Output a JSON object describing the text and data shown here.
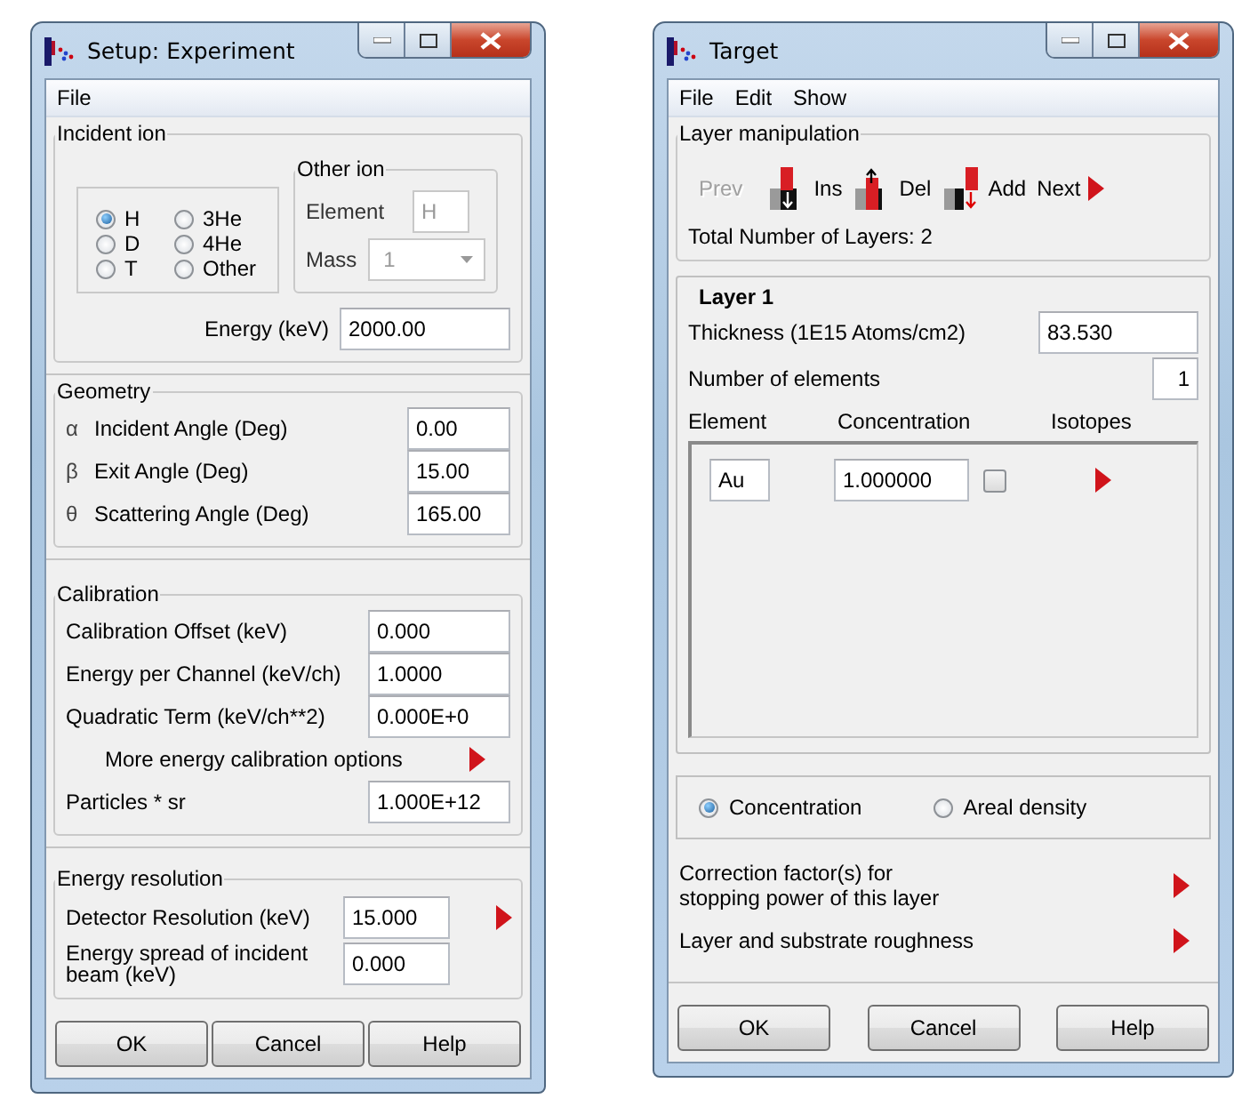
{
  "setup_window": {
    "title": "Setup: Experiment",
    "menu": [
      "File"
    ],
    "incident_ion": {
      "legend": "Incident ion",
      "options": [
        {
          "label": "H",
          "selected": true
        },
        {
          "label": "3He",
          "selected": false
        },
        {
          "label": "D",
          "selected": false
        },
        {
          "label": "4He",
          "selected": false
        },
        {
          "label": "T",
          "selected": false
        },
        {
          "label": "Other",
          "selected": false
        }
      ],
      "other_ion": {
        "legend": "Other ion",
        "element_label": "Element",
        "element_value": "H",
        "mass_label": "Mass",
        "mass_value": "1",
        "disabled": true
      },
      "energy_label": "Energy (keV)",
      "energy_value": "2000.00"
    },
    "geometry": {
      "legend": "Geometry",
      "rows": [
        {
          "symbol": "α",
          "label": "Incident Angle (Deg)",
          "value": "0.00"
        },
        {
          "symbol": "β",
          "label": "Exit Angle (Deg)",
          "value": "15.00"
        },
        {
          "symbol": "θ",
          "label": "Scattering Angle (Deg)",
          "value": "165.00"
        }
      ]
    },
    "calibration": {
      "legend": "Calibration",
      "rows": [
        {
          "kind": "field",
          "label": "Calibration Offset (keV)",
          "value": "0.000"
        },
        {
          "kind": "field",
          "label": "Energy per Channel (keV/ch)",
          "value": "1.0000"
        },
        {
          "kind": "field",
          "label": "Quadratic Term (keV/ch**2)",
          "value": "0.000E+0"
        },
        {
          "kind": "link",
          "label": "More energy calibration options"
        },
        {
          "kind": "field",
          "label": "Particles * sr",
          "value": "1.000E+12"
        }
      ]
    },
    "energy_resolution": {
      "legend": "Energy resolution",
      "rows": [
        {
          "label": "Detector Resolution (keV)",
          "value": "15.000",
          "more": true
        },
        {
          "label": "Energy spread of incident beam (keV)",
          "value": "0.000",
          "more": false
        }
      ]
    },
    "buttons": [
      "OK",
      "Cancel",
      "Help"
    ]
  },
  "target_window": {
    "title": "Target",
    "menu": [
      "File",
      "Edit",
      "Show"
    ],
    "layer_manipulation": {
      "legend": "Layer manipulation",
      "actions": [
        {
          "kind": "prev",
          "label": "Prev",
          "disabled": true
        },
        {
          "kind": "insert",
          "label": "Ins",
          "disabled": false
        },
        {
          "kind": "delete",
          "label": "Del",
          "disabled": false
        },
        {
          "kind": "add",
          "label": "Add",
          "disabled": false
        },
        {
          "kind": "next",
          "label": "Next",
          "disabled": false
        }
      ],
      "total": "Total Number of Layers: 2"
    },
    "layer": {
      "title": "Layer 1",
      "thickness_label": "Thickness (1E15 Atoms/cm2)",
      "thickness_value": "83.530",
      "count_label": "Number of elements",
      "count_value": "1",
      "columns": [
        "Element",
        "Concentration",
        "Isotopes"
      ],
      "elements": [
        {
          "element": "Au",
          "concentration": "1.000000",
          "checked": false
        }
      ]
    },
    "modes": [
      {
        "label": "Concentration",
        "selected": true
      },
      {
        "label": "Areal density",
        "selected": false
      }
    ],
    "links": [
      "Correction factor(s) for stopping power of this layer",
      "Layer and substrate roughness"
    ],
    "buttons": [
      "OK",
      "Cancel",
      "Help"
    ]
  }
}
